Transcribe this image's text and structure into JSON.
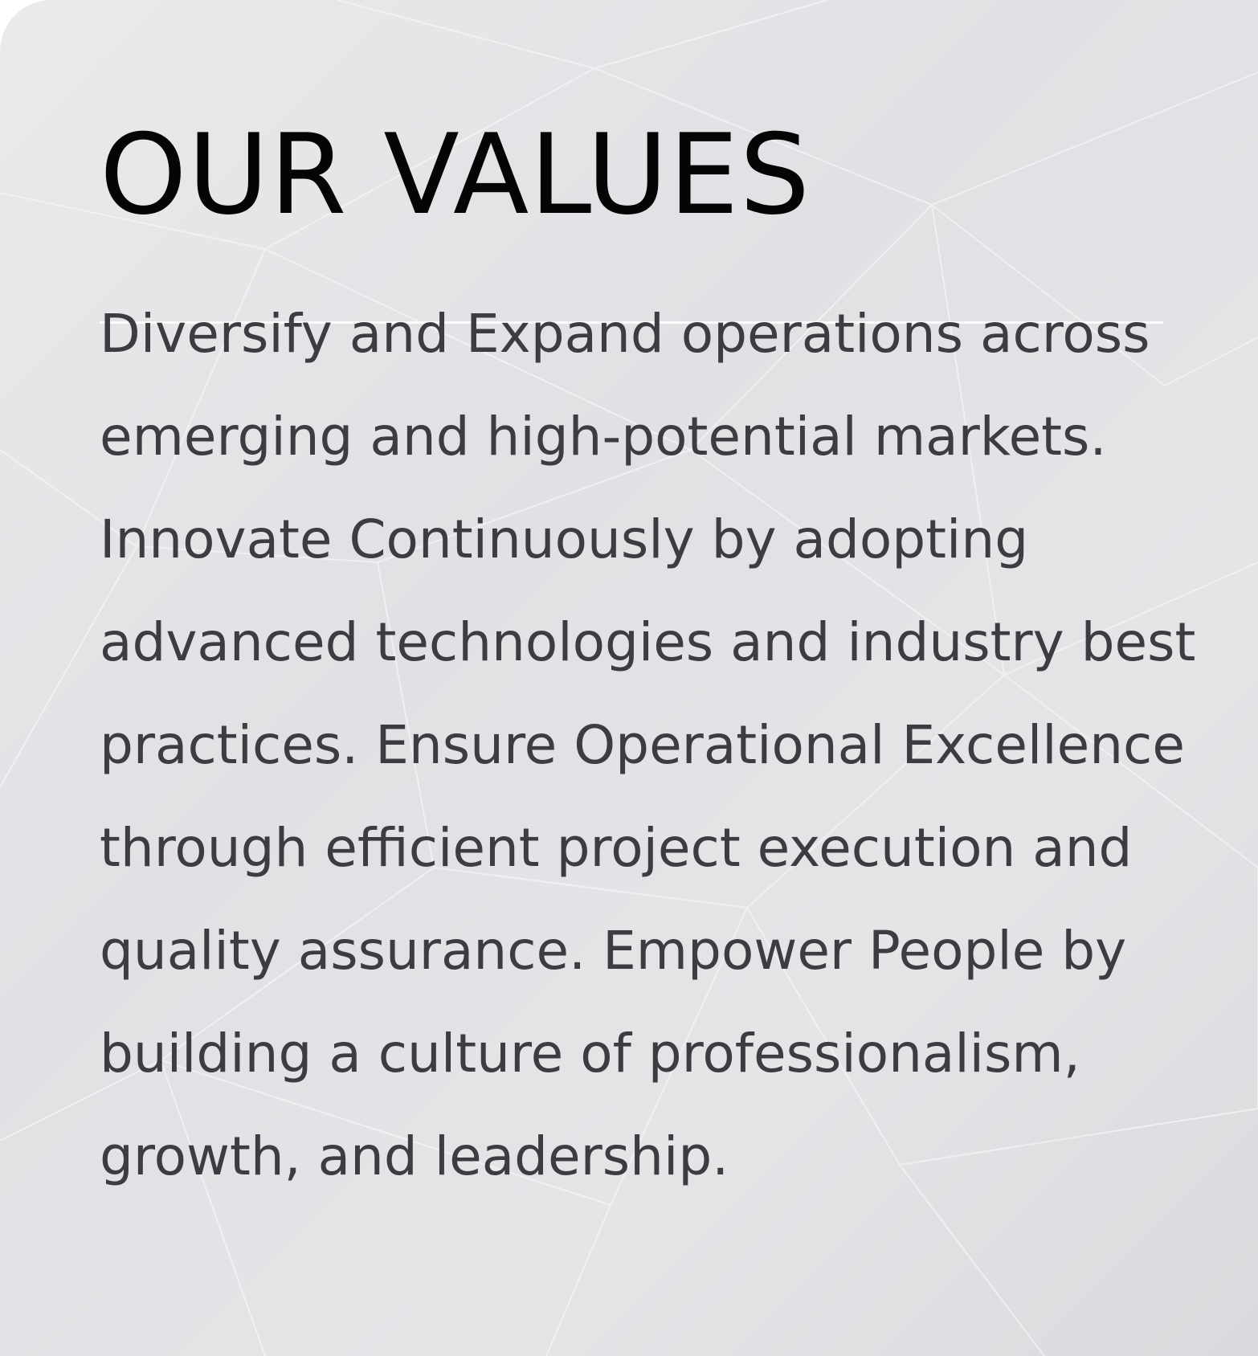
{
  "section": {
    "title": "OUR VALUES",
    "body": "Diversify and Expand operations across emerging and high-potential markets. Innovate Continuously by adopting advanced technologies and industry best practices. Ensure Operational Excellence through efficient project execution and quality assurance. Empower People by building a culture of professionalism, growth, and leadership."
  },
  "colors": {
    "card_background": "#e2e4e6",
    "title": "#050505",
    "body_text": "#3c3d41",
    "divider": "#ffffff"
  }
}
